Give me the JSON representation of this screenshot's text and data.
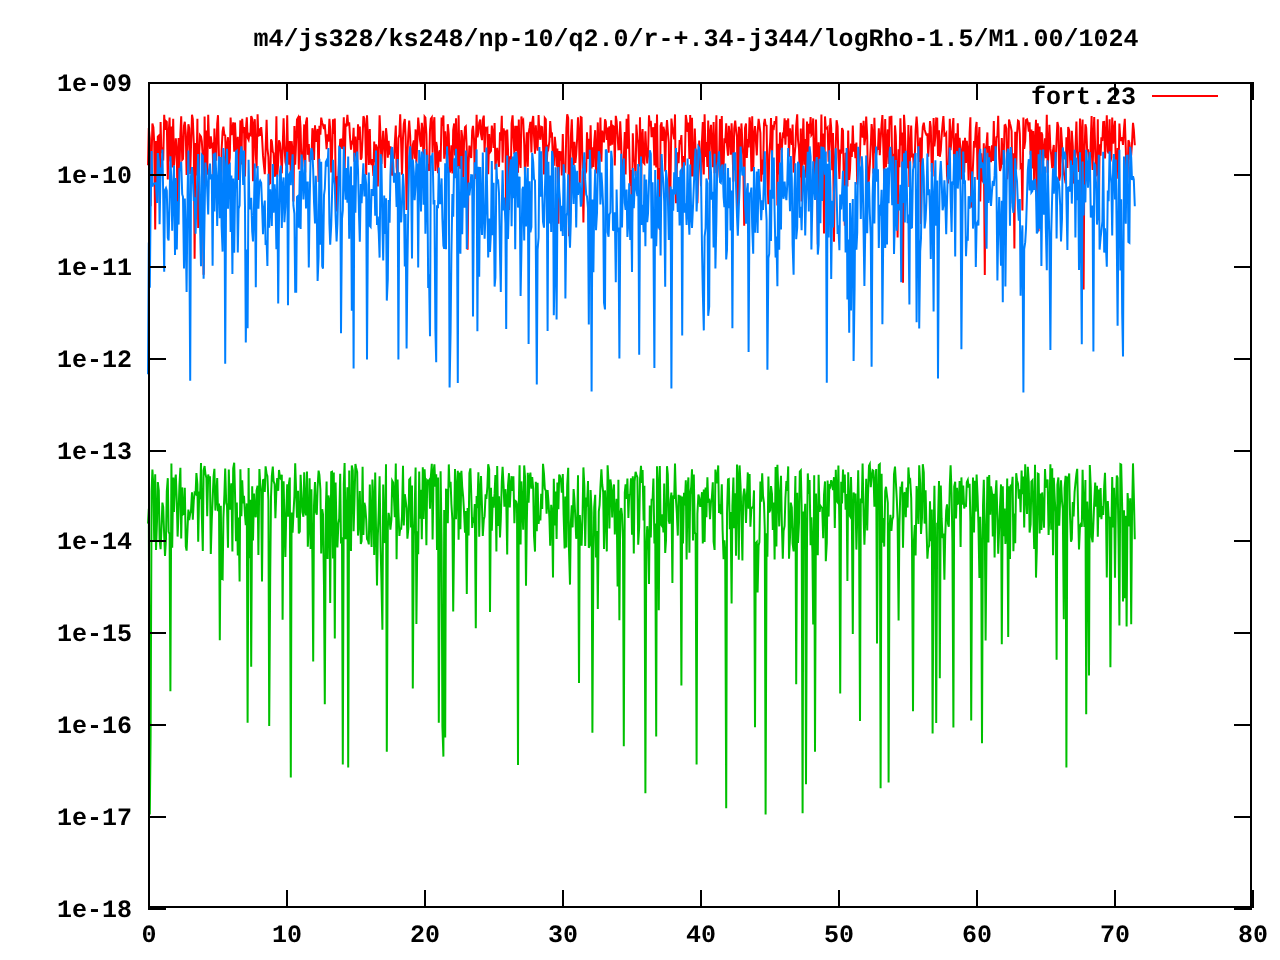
{
  "title": "m4/js328/ks248/np-10/q2.0/r-+.34-j344/logRho-1.5/M1.00/1024",
  "legend": [
    {
      "label": "fort.23"
    }
  ],
  "y_axis": {
    "tick_labels": [
      "1e-09",
      "1e-10",
      "1e-11",
      "1e-12",
      "1e-13",
      "1e-14",
      "1e-15",
      "1e-16",
      "1e-17",
      "1e-18"
    ]
  },
  "x_axis": {
    "tick_labels": [
      "0",
      "10",
      "20",
      "30",
      "40",
      "50",
      "60",
      "70",
      "80"
    ]
  }
}
